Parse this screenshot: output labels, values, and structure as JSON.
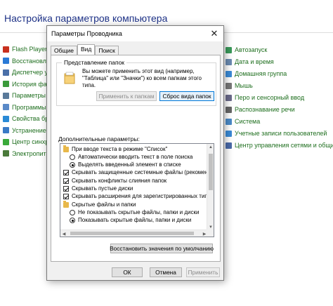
{
  "background": {
    "title": "Настройка параметров компьютера",
    "left_items": [
      {
        "label": "Flash Player (32",
        "icon": "flash-player-icon",
        "color": "#c8301e"
      },
      {
        "label": "Восстановлени",
        "icon": "recovery-icon",
        "color": "#2a7ad6"
      },
      {
        "label": "Диспетчер уст",
        "icon": "device-manager-icon",
        "color": "#4a6fa8"
      },
      {
        "label": "История файл",
        "icon": "file-history-icon",
        "color": "#3a9a3a"
      },
      {
        "label": "Параметры и",
        "icon": "indexing-icon",
        "color": "#5a7a9a"
      },
      {
        "label": "Программы и",
        "icon": "programs-icon",
        "color": "#5a8ac8"
      },
      {
        "label": "Свойства брау",
        "icon": "browser-icon",
        "color": "#2a8ad6"
      },
      {
        "label": "Устранение н",
        "icon": "troubleshoot-icon",
        "color": "#3a7ac6"
      },
      {
        "label": "Центр синхро",
        "icon": "sync-center-icon",
        "color": "#3aaa3a"
      },
      {
        "label": "Электропитан",
        "icon": "power-icon",
        "color": "#4a7a3a"
      }
    ],
    "right_items": [
      {
        "label": "Автозапуск",
        "icon": "autoplay-icon",
        "color": "#3a9a5a"
      },
      {
        "label": "Дата и время",
        "icon": "date-time-icon",
        "color": "#6a8ab0"
      },
      {
        "label": "Домашняя группа",
        "icon": "homegroup-icon",
        "color": "#3a8ad6"
      },
      {
        "label": "Мышь",
        "icon": "mouse-icon",
        "color": "#777777"
      },
      {
        "label": "Перо и сенсорный ввод",
        "icon": "pen-touch-icon",
        "color": "#6a6a8a"
      },
      {
        "label": "Распознавание речи",
        "icon": "microphone-icon",
        "color": "#666666"
      },
      {
        "label": "Система",
        "icon": "system-icon",
        "color": "#4a8ac8"
      },
      {
        "label": "Учетные записи пользователей",
        "icon": "user-accounts-icon",
        "color": "#3a8ad6"
      },
      {
        "label": "Центр управления сетями и общи",
        "icon": "network-center-icon",
        "color": "#4a6aa8"
      }
    ]
  },
  "dialog": {
    "title": "Параметры Проводника",
    "close_glyph": "✕",
    "tabs": [
      {
        "label": "Общие",
        "active": false
      },
      {
        "label": "Вид",
        "active": true
      },
      {
        "label": "Поиск",
        "active": false
      }
    ],
    "folder_views": {
      "title": "Представление папок",
      "description": "Вы можете применить этот вид (например, \"Таблица\" или \"Значки\") ко всем папкам этого типа.",
      "apply_button": "Применить к папкам",
      "reset_button": "Сброс вида папок"
    },
    "advanced": {
      "label": "Дополнительные параметры:",
      "items": [
        {
          "kind": "folder",
          "text": "При вводе текста в режиме \"Список\"",
          "checked": false,
          "level": 1
        },
        {
          "kind": "radio",
          "text": "Автоматически вводить текст в поле поиска",
          "checked": false,
          "level": 2
        },
        {
          "kind": "radio",
          "text": "Выделять введенный элемент в списке",
          "checked": true,
          "level": 2
        },
        {
          "kind": "checkbox",
          "text": "Скрывать защищенные системные файлы (рекомен",
          "checked": true,
          "level": 1
        },
        {
          "kind": "checkbox",
          "text": "Скрывать конфликты слияния папок",
          "checked": true,
          "level": 1
        },
        {
          "kind": "checkbox",
          "text": "Скрывать пустые диски",
          "checked": true,
          "level": 1
        },
        {
          "kind": "checkbox",
          "text": "Скрывать расширения для зарегистрированных типо",
          "checked": true,
          "level": 1
        },
        {
          "kind": "folder",
          "text": "Скрытые файлы и папки",
          "checked": false,
          "level": 1
        },
        {
          "kind": "radio",
          "text": "Не показывать скрытые файлы, папки и диски",
          "checked": false,
          "level": 2
        },
        {
          "kind": "radio",
          "text": "Показывать скрытые файлы, папки и диски",
          "checked": true,
          "level": 2
        }
      ]
    },
    "restore_button": "Восстановить значения по умолчанию",
    "ok_button": "ОК",
    "cancel_button": "Отмена",
    "apply_button": "Применить"
  }
}
